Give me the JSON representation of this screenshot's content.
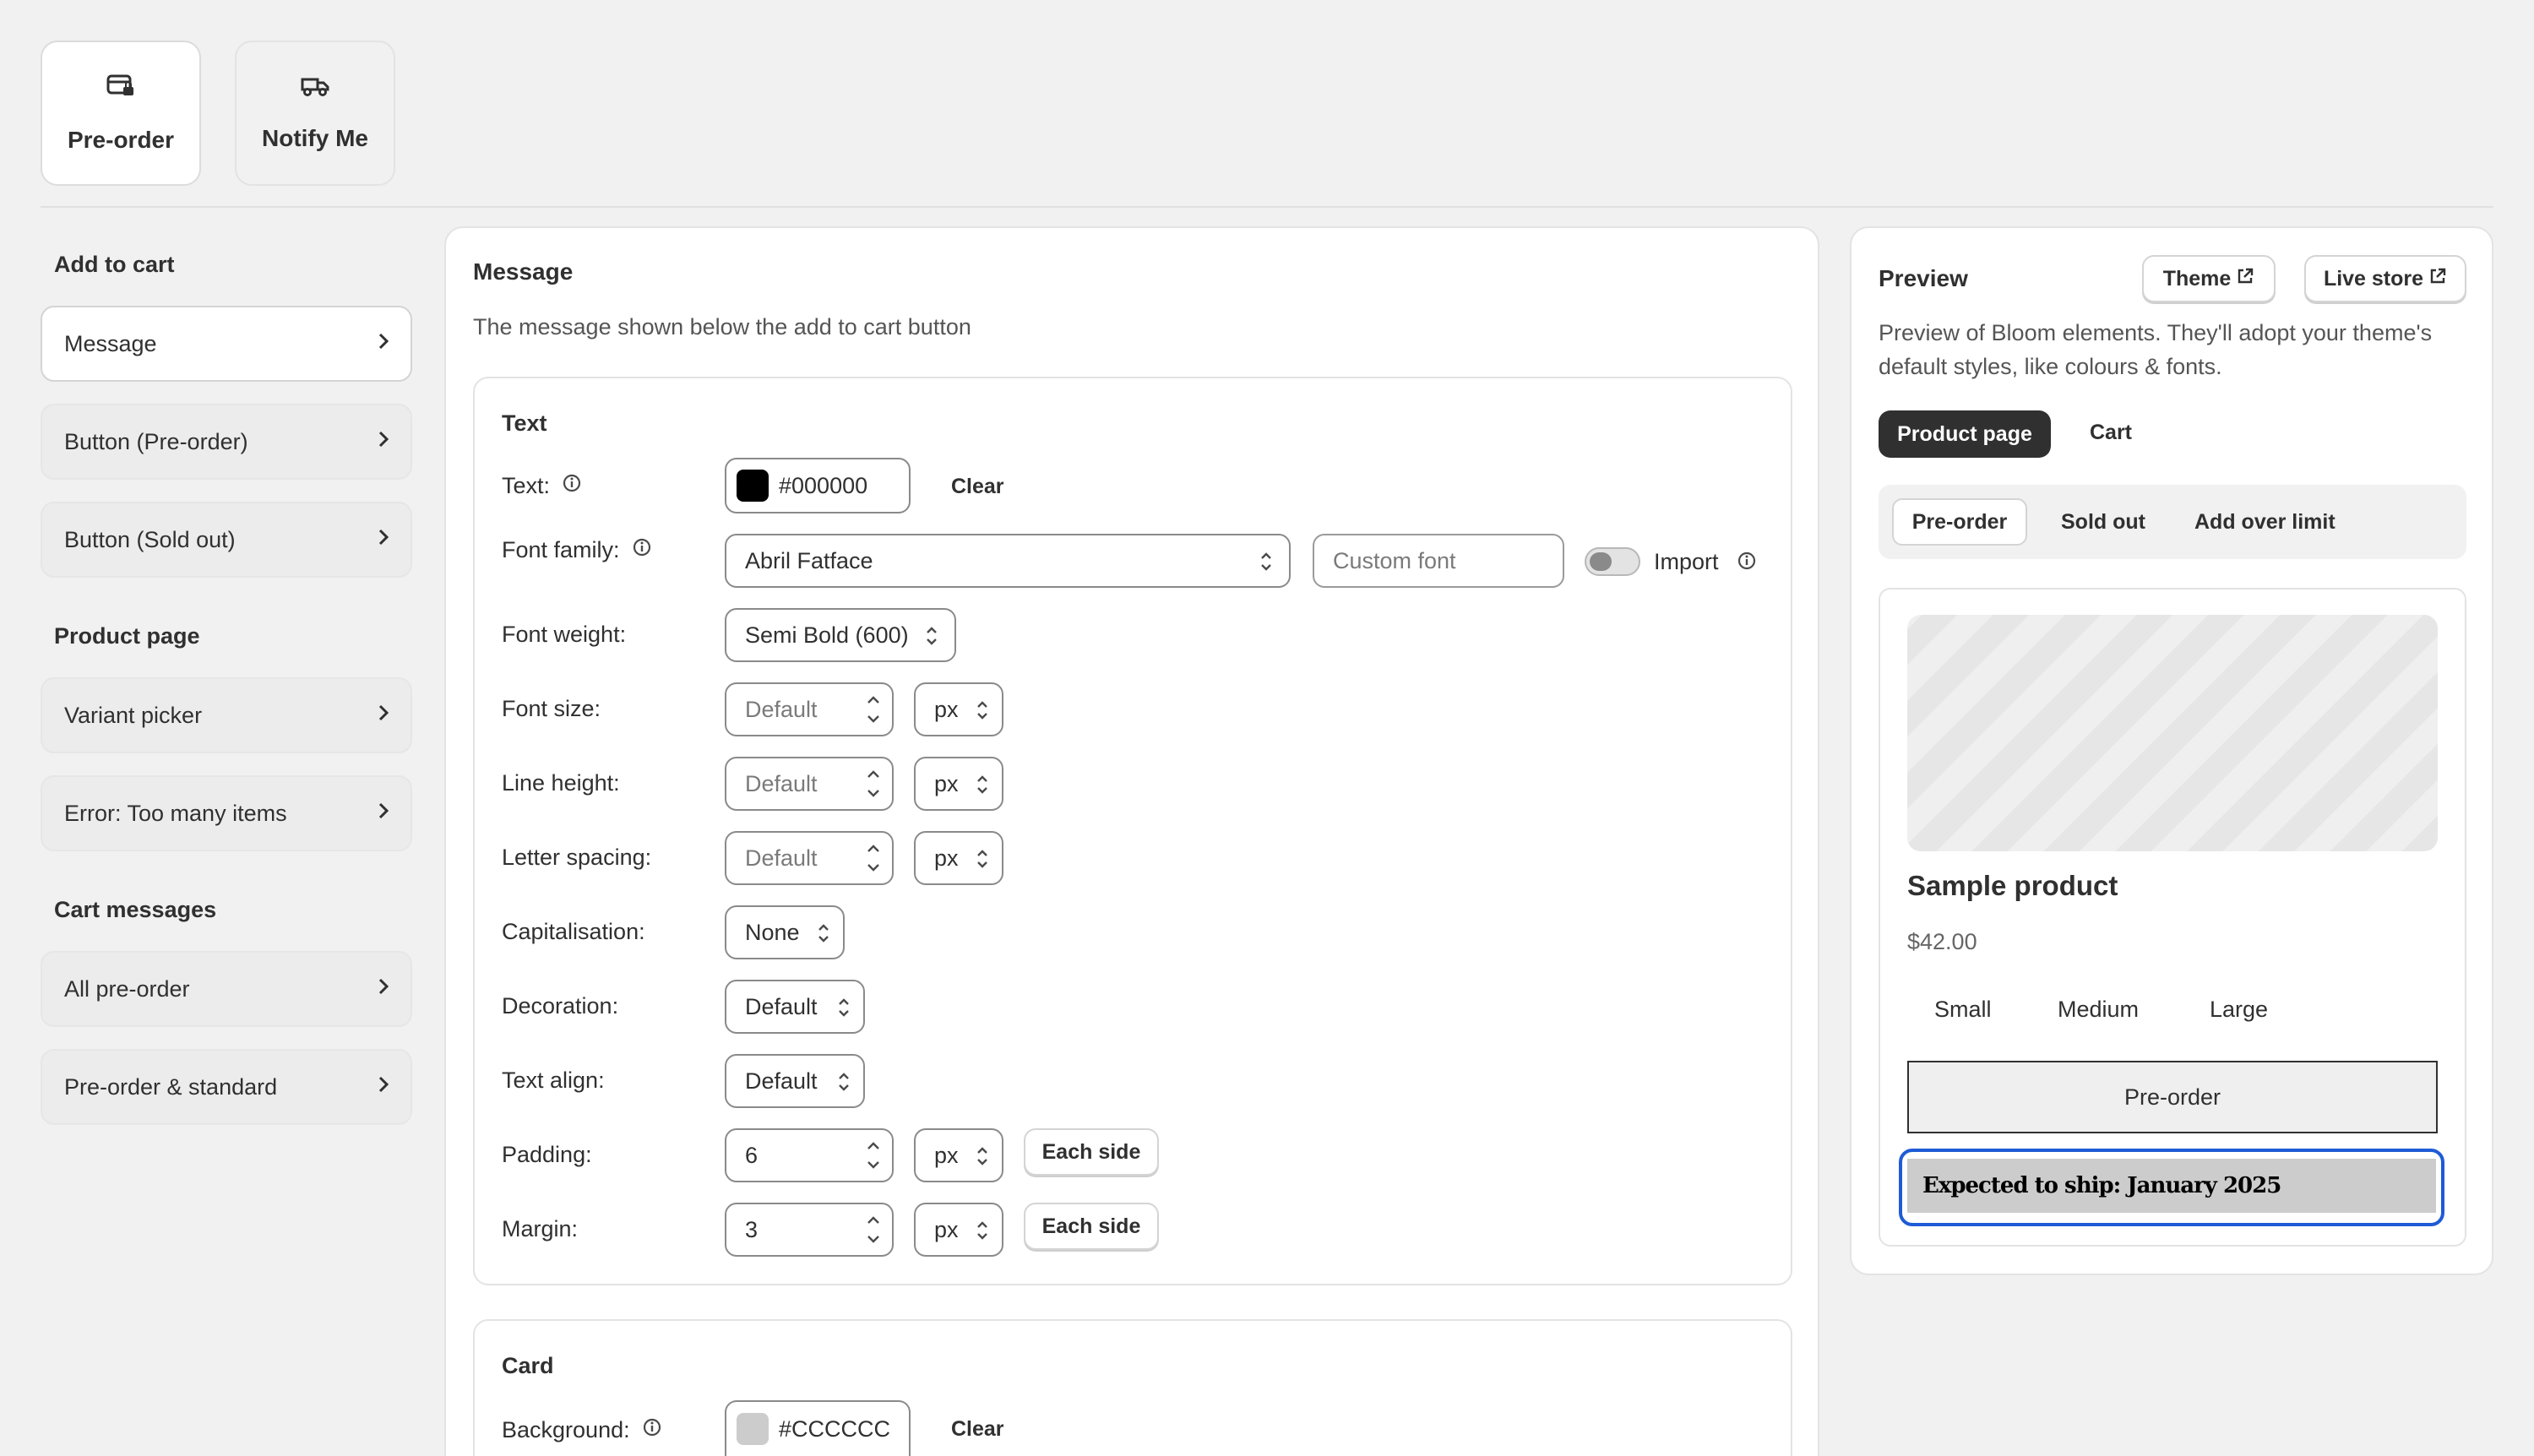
{
  "tabs": [
    {
      "label": "Pre-order",
      "icon": "preorder-card-icon"
    },
    {
      "label": "Notify Me",
      "icon": "truck-icon"
    }
  ],
  "nav": {
    "sections": [
      {
        "title": "Add to cart",
        "items": [
          "Message",
          "Button (Pre-order)",
          "Button (Sold out)"
        ]
      },
      {
        "title": "Product page",
        "items": [
          "Variant picker",
          "Error: Too many items"
        ]
      },
      {
        "title": "Cart messages",
        "items": [
          "All pre-order",
          "Pre-order & standard"
        ]
      }
    ]
  },
  "main": {
    "title": "Message",
    "description": "The message shown below the add to cart button",
    "text_section": {
      "title": "Text",
      "text_label": "Text:",
      "text_color": "#000000",
      "clear": "Clear",
      "font_family_label": "Font family:",
      "font_family_value": "Abril Fatface",
      "custom_font_placeholder": "Custom font",
      "import_label": "Import",
      "font_weight_label": "Font weight:",
      "font_weight_value": "Semi Bold (600)",
      "font_size_label": "Font size:",
      "line_height_label": "Line height:",
      "letter_spacing_label": "Letter spacing:",
      "default_placeholder": "Default",
      "unit": "px",
      "capitalisation_label": "Capitalisation:",
      "capitalisation_value": "None",
      "decoration_label": "Decoration:",
      "decoration_value": "Default",
      "text_align_label": "Text align:",
      "text_align_value": "Default",
      "padding_label": "Padding:",
      "padding_value": "6",
      "margin_label": "Margin:",
      "margin_value": "3",
      "each_side": "Each side"
    },
    "card_section": {
      "title": "Card",
      "background_label": "Background:",
      "background_value": "#CCCCCC",
      "clear": "Clear"
    }
  },
  "preview": {
    "title": "Preview",
    "theme_button": "Theme",
    "live_store_button": "Live store",
    "description": "Preview of Bloom elements. They'll adopt your theme's default styles, like colours & fonts.",
    "page_tabs": [
      "Product page",
      "Cart"
    ],
    "state_tabs": [
      "Pre-order",
      "Sold out",
      "Add over limit"
    ],
    "product_name": "Sample product",
    "price": "$42.00",
    "variants": [
      "Small",
      "Medium",
      "Large"
    ],
    "button_label": "Pre-order",
    "message": "Expected to ship: January 2025",
    "colors": {
      "accent": "#1f5bd6",
      "dark_tab": "#303030",
      "message_bg": "#cccccc"
    }
  }
}
